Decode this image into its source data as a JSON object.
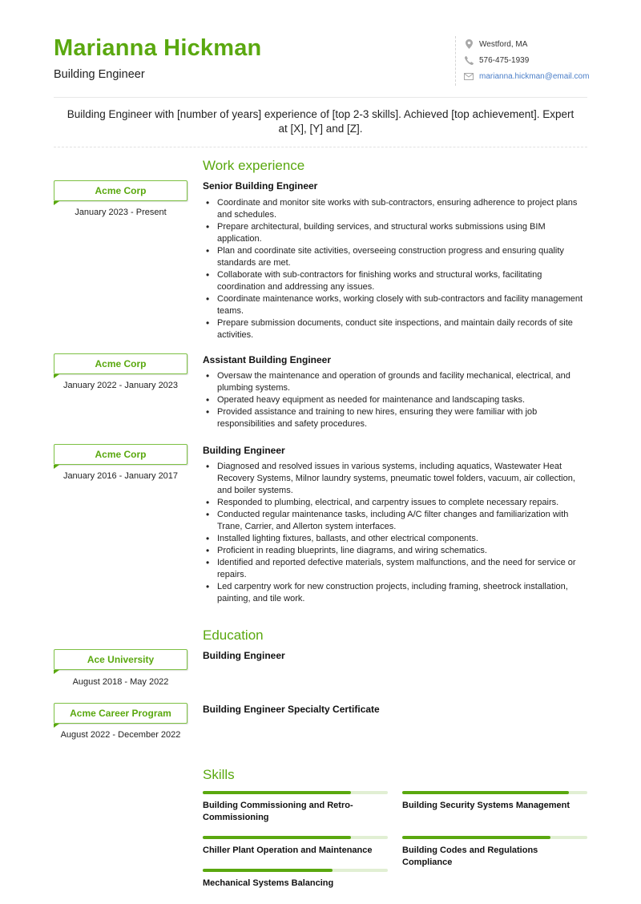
{
  "header": {
    "name": "Marianna Hickman",
    "title": "Building Engineer",
    "accent_color": "#5aa80f"
  },
  "contact": [
    {
      "icon": "location-pin-icon",
      "text": "Westford, MA"
    },
    {
      "icon": "phone-icon",
      "text": "576-475-1939"
    },
    {
      "icon": "envelope-icon",
      "text": "marianna.hickman@email.com"
    }
  ],
  "summary": "Building Engineer with [number of years] experience of [top 2-3 skills]. Achieved [top achievement]. Expert at [X], [Y] and [Z].",
  "work": {
    "title": "Work experience",
    "jobs": [
      {
        "company": "Acme Corp",
        "dates": "January 2023 - Present",
        "role": "Senior Building Engineer",
        "bullets": [
          "Coordinate and monitor site works with sub-contractors, ensuring adherence to project plans and schedules.",
          "Prepare architectural, building services, and structural works submissions using BIM application.",
          "Plan and coordinate site activities, overseeing construction progress and ensuring quality standards are met.",
          "Collaborate with sub-contractors for finishing works and structural works, facilitating coordination and addressing any issues.",
          "Coordinate maintenance works, working closely with sub-contractors and facility management teams.",
          "Prepare submission documents, conduct site inspections, and maintain daily records of site activities."
        ]
      },
      {
        "company": "Acme Corp",
        "dates": "January 2022 - January 2023",
        "role": "Assistant Building Engineer",
        "bullets": [
          "Oversaw the maintenance and operation of grounds and facility mechanical, electrical, and plumbing systems.",
          "Operated heavy equipment as needed for maintenance and landscaping tasks.",
          "Provided assistance and training to new hires, ensuring they were familiar with job responsibilities and safety procedures."
        ]
      },
      {
        "company": "Acme Corp",
        "dates": "January 2016 - January 2017",
        "role": "Building Engineer",
        "bullets": [
          "Diagnosed and resolved issues in various systems, including aquatics, Wastewater Heat Recovery Systems, Milnor laundry systems, pneumatic towel folders, vacuum, air collection, and boiler systems.",
          "Responded to plumbing, electrical, and carpentry issues to complete necessary repairs.",
          "Conducted regular maintenance tasks, including A/C filter changes and familiarization with Trane, Carrier, and Allerton system interfaces.",
          "Installed lighting fixtures, ballasts, and other electrical components.",
          "Proficient in reading blueprints, line diagrams, and wiring schematics.",
          "Identified and reported defective materials, system malfunctions, and the need for service or repairs.",
          "Led carpentry work for new construction projects, including framing, sheetrock installation, painting, and tile work."
        ]
      }
    ]
  },
  "education": {
    "title": "Education",
    "items": [
      {
        "school": "Ace University",
        "dates": "August 2018 - May 2022",
        "degree": "Building Engineer"
      },
      {
        "school": "Acme Career Program",
        "dates": "August 2022 - December 2022",
        "degree": "Building Engineer Specialty Certificate"
      }
    ]
  },
  "skills": {
    "title": "Skills",
    "items": [
      {
        "name": "Building Commissioning and Retro-Commissioning",
        "level_percent": 80
      },
      {
        "name": "Building Security Systems Management",
        "level_percent": 90
      },
      {
        "name": "Chiller Plant Operation and Maintenance",
        "level_percent": 80
      },
      {
        "name": "Building Codes and Regulations Compliance",
        "level_percent": 80
      },
      {
        "name": "Mechanical Systems Balancing",
        "level_percent": 70
      }
    ]
  }
}
